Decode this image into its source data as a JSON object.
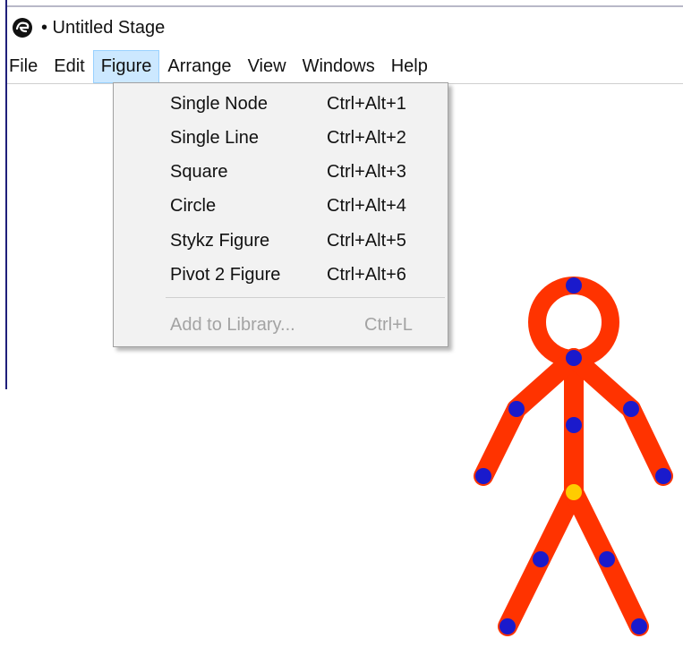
{
  "window": {
    "title": "• Untitled Stage",
    "icon": "app-logo-icon"
  },
  "menubar": {
    "items": [
      {
        "label": "File"
      },
      {
        "label": "Edit"
      },
      {
        "label": "Figure"
      },
      {
        "label": "Arrange"
      },
      {
        "label": "View"
      },
      {
        "label": "Windows"
      },
      {
        "label": "Help"
      }
    ],
    "active": "Figure"
  },
  "figure_menu": {
    "items": [
      {
        "label": "Single Node",
        "shortcut": "Ctrl+Alt+1",
        "enabled": true
      },
      {
        "label": "Single Line",
        "shortcut": "Ctrl+Alt+2",
        "enabled": true
      },
      {
        "label": "Square",
        "shortcut": "Ctrl+Alt+3",
        "enabled": true
      },
      {
        "label": "Circle",
        "shortcut": "Ctrl+Alt+4",
        "enabled": true
      },
      {
        "label": "Stykz Figure",
        "shortcut": "Ctrl+Alt+5",
        "enabled": true
      },
      {
        "label": "Pivot 2 Figure",
        "shortcut": "Ctrl+Alt+6",
        "enabled": true
      },
      {
        "label": "Add to Library...",
        "shortcut": "Ctrl+L",
        "enabled": false
      }
    ]
  },
  "stage": {
    "figure": "stick-figure",
    "colors": {
      "limb": "#ff3300",
      "node": "#1a1acc",
      "root_node": "#ffcc00"
    }
  }
}
